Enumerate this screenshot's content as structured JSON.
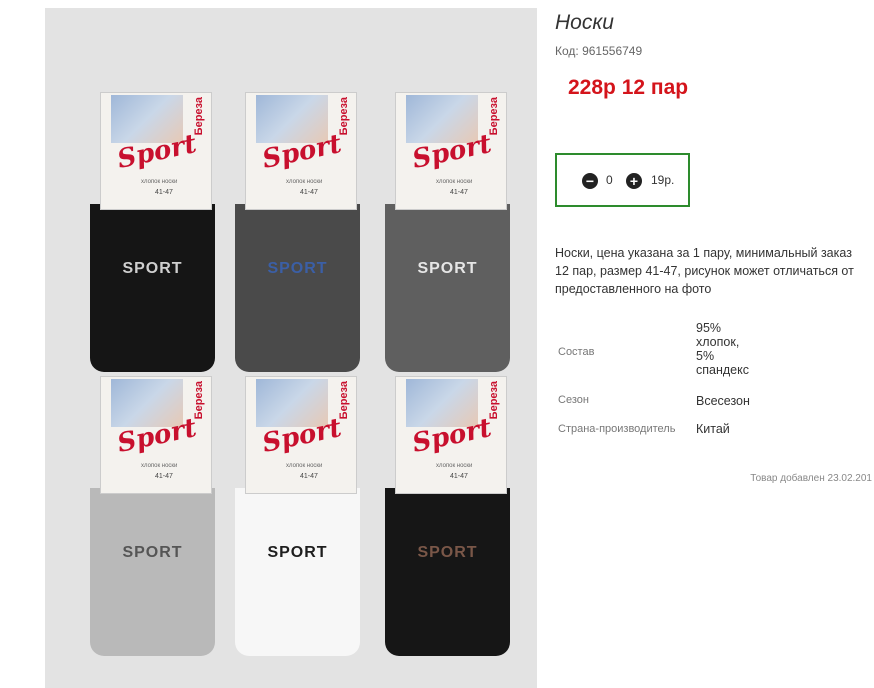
{
  "product": {
    "title": "Носки",
    "code": "Код: 961556749",
    "price": "228р 12 пар",
    "description": "Носки, цена указана за 1 пару, минимальный заказ 12 пар, размер 41-47, рисунок может отличаться от предоставленного на фото",
    "added": "Товар добавлен 23.02.201"
  },
  "quantity": {
    "minus_icon": "minus-circle-icon",
    "plus_icon": "plus-circle-icon",
    "value": "0",
    "unit_price": "19р.",
    "border_color": "#2d8b2d"
  },
  "specs": [
    {
      "label": "Состав",
      "value_lines": [
        "95%",
        "хлопок,",
        "5%",
        "спандекс"
      ]
    },
    {
      "label": "Сезон",
      "value": "Всесезон"
    },
    {
      "label": "Страна-производитель",
      "value": "Китай"
    }
  ],
  "photo": {
    "brand": "Береза",
    "logo": "Sport",
    "sub": "хлопок носки",
    "size": "41-47",
    "sock_word": "SPORT",
    "socks": [
      {
        "color": "#151515",
        "word_color": "#cfcfcf"
      },
      {
        "color": "#4a4a4a",
        "word_color": "#3b5fa6"
      },
      {
        "color": "#5f5f5f",
        "word_color": "#e6e6e6"
      },
      {
        "color": "#b9b9b9",
        "word_color": "#555555"
      },
      {
        "color": "#f7f7f7",
        "word_color": "#1e1e1e"
      },
      {
        "color": "#161616",
        "word_color": "#7a5748"
      }
    ]
  },
  "colors": {
    "price": "#d4141b",
    "accent": "#2d8b2d"
  }
}
